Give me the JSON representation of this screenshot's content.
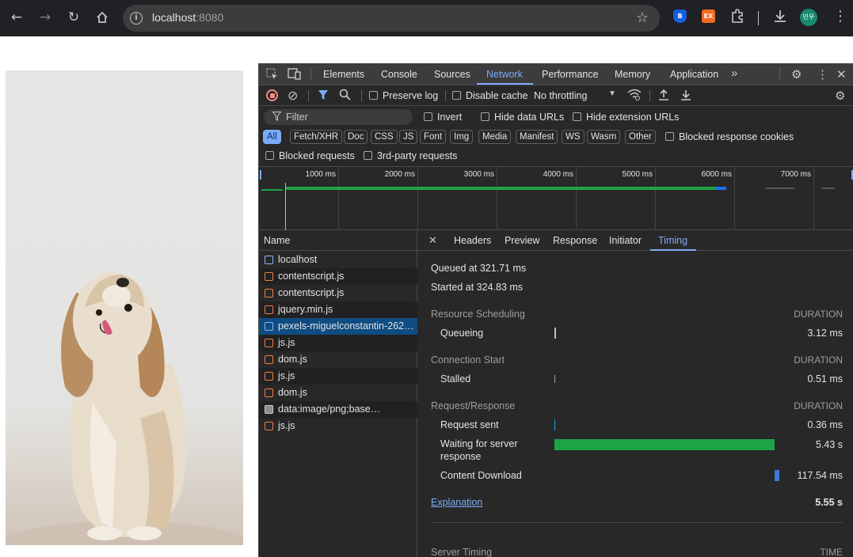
{
  "browser": {
    "url_host": "localhost",
    "url_port": ":8080",
    "ext_ex_label": "EX",
    "avatar_label": "민우",
    "bitwarden_label": "B"
  },
  "devtools": {
    "tabs": [
      "Elements",
      "Console",
      "Sources",
      "Network",
      "Performance",
      "Memory",
      "Application"
    ],
    "active_tab": "Network",
    "toolbar": {
      "preserve_log": "Preserve log",
      "disable_cache": "Disable cache",
      "throttling": "No throttling"
    },
    "filter": {
      "placeholder": "Filter",
      "invert": "Invert",
      "hide_data_urls": "Hide data URLs",
      "hide_extension_urls": "Hide extension URLs",
      "types": [
        "All",
        "Fetch/XHR",
        "Doc",
        "CSS",
        "JS",
        "Font",
        "Img",
        "Media",
        "Manifest",
        "WS",
        "Wasm",
        "Other"
      ],
      "blocked_response_cookies": "Blocked response cookies",
      "blocked_requests": "Blocked requests",
      "third_party_requests": "3rd-party requests"
    },
    "overview_ticks": [
      "1000 ms",
      "2000 ms",
      "3000 ms",
      "4000 ms",
      "5000 ms",
      "6000 ms",
      "7000 ms"
    ],
    "name_header": "Name",
    "requests": [
      {
        "name": "localhost",
        "type": "doc"
      },
      {
        "name": "contentscript.js",
        "type": "js"
      },
      {
        "name": "contentscript.js",
        "type": "js"
      },
      {
        "name": "jquery.min.js",
        "type": "js"
      },
      {
        "name": "pexels-miguelconstantin-262…",
        "type": "doc"
      },
      {
        "name": "js.js",
        "type": "js"
      },
      {
        "name": "dom.js",
        "type": "js"
      },
      {
        "name": "js.js",
        "type": "js"
      },
      {
        "name": "dom.js",
        "type": "js"
      },
      {
        "name": "data:image/png;base…",
        "type": "img"
      },
      {
        "name": "js.js",
        "type": "js"
      }
    ],
    "detail_tabs": [
      "Headers",
      "Preview",
      "Response",
      "Initiator",
      "Timing"
    ],
    "active_detail_tab": "Timing",
    "timing": {
      "queued_at": "Queued at 321.71 ms",
      "started_at": "Started at 324.83 ms",
      "duration_label": "DURATION",
      "sections": {
        "resource_scheduling": "Resource Scheduling",
        "connection_start": "Connection Start",
        "request_response": "Request/Response",
        "server_timing": "Server Timing"
      },
      "rows": {
        "queueing": {
          "label": "Queueing",
          "value": "3.12 ms"
        },
        "stalled": {
          "label": "Stalled",
          "value": "0.51 ms"
        },
        "request_sent": {
          "label": "Request sent",
          "value": "0.36 ms"
        },
        "waiting_1": "Waiting for server",
        "waiting_2": "response",
        "waiting_value": "5.43 s",
        "content_download": {
          "label": "Content Download",
          "value": "117.54 ms"
        }
      },
      "explanation": "Explanation",
      "total": "5.55 s",
      "time_label": "TIME"
    },
    "colors": {
      "waiting_bar": "#1ea446",
      "download_bar": "#3c78d8",
      "accent": "#7cacf8"
    }
  }
}
